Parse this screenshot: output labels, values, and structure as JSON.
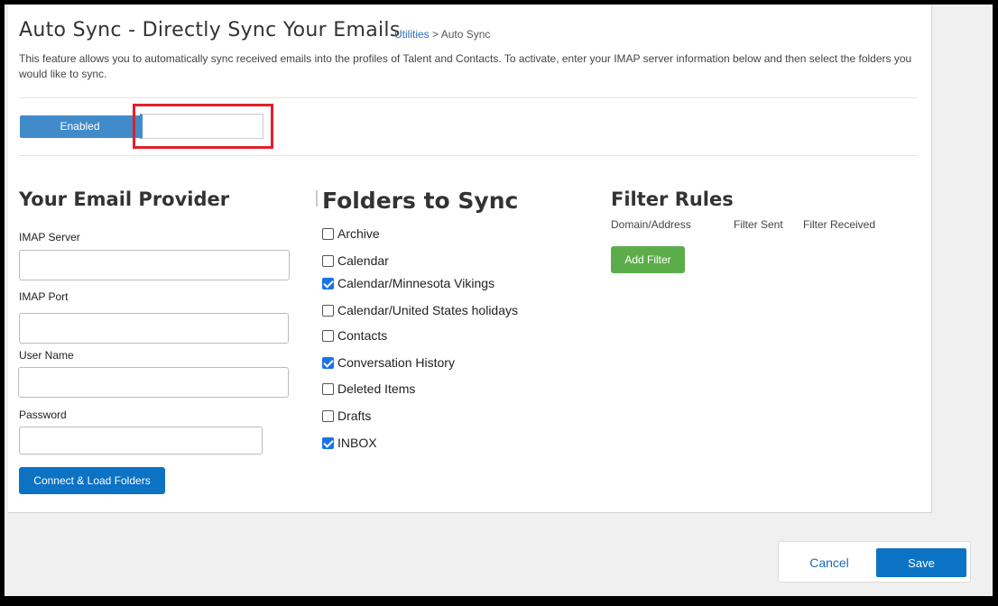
{
  "header": {
    "title": "Auto Sync - Directly Sync Your Emails",
    "breadcrumb_link": "Utilities",
    "breadcrumb_sep": " > ",
    "breadcrumb_current": "Auto Sync",
    "description": "This feature allows you to automatically sync received emails into the profiles of Talent and Contacts. To activate, enter your IMAP server information below and then select the folders you would like to sync."
  },
  "toggle": {
    "on_label": "Enabled",
    "state": "enabled"
  },
  "provider": {
    "heading": "Your Email Provider",
    "fields": [
      {
        "label": "IMAP Server",
        "value": ""
      },
      {
        "label": "IMAP Port",
        "value": ""
      },
      {
        "label": "User Name",
        "value": ""
      },
      {
        "label": "Password",
        "value": ""
      }
    ],
    "connect_label": "Connect & Load Folders"
  },
  "folders": {
    "heading": "Folders to Sync",
    "items": [
      {
        "label": "Archive",
        "checked": false
      },
      {
        "label": "Calendar",
        "checked": false
      },
      {
        "label": "Calendar/Minnesota Vikings",
        "checked": true
      },
      {
        "label": "Calendar/United States holidays",
        "checked": false
      },
      {
        "label": "Contacts",
        "checked": false
      },
      {
        "label": "Conversation History",
        "checked": true
      },
      {
        "label": "Deleted Items",
        "checked": false
      },
      {
        "label": "Drafts",
        "checked": false
      },
      {
        "label": "INBOX",
        "checked": true
      }
    ]
  },
  "filters": {
    "heading": "Filter Rules",
    "columns": [
      "Domain/Address",
      "Filter Sent",
      "Filter Received"
    ],
    "add_label": "Add Filter"
  },
  "footer": {
    "cancel_label": "Cancel",
    "save_label": "Save"
  },
  "colors": {
    "primary": "#0b72c4",
    "toggle": "#428bca",
    "success": "#5cad4a",
    "highlight": "#e0202a",
    "checkbox": "#1a73e8"
  }
}
